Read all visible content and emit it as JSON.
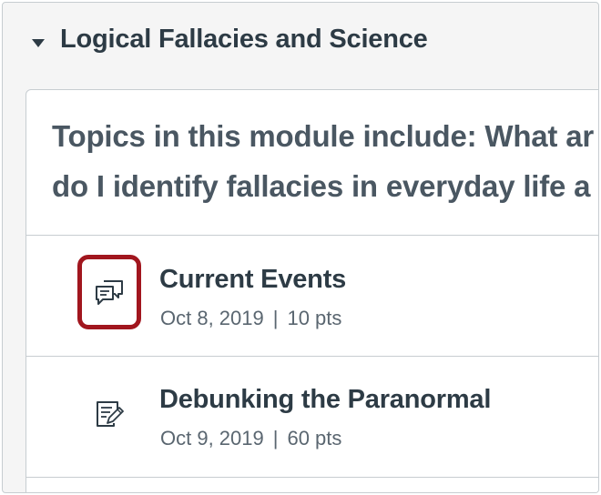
{
  "module": {
    "title": "Logical Fallacies and Science",
    "description_lines": [
      "Topics in this module include: What ar",
      "do I identify fallacies in everyday life a"
    ],
    "items": [
      {
        "title": "Current Events",
        "date": "Oct 8, 2019",
        "separator": "|",
        "points": "10 pts",
        "icon": "discussion-icon",
        "highlighted": true
      },
      {
        "title": "Debunking the Paranormal",
        "date": "Oct 9, 2019",
        "separator": "|",
        "points": "60 pts",
        "icon": "assignment-icon",
        "highlighted": false
      }
    ]
  },
  "colors": {
    "text_dark": "#2d3b45",
    "text_meta": "#5a6670",
    "highlight": "#a1161e",
    "border": "#c7cdd1",
    "header_bg": "#f5f5f5"
  }
}
